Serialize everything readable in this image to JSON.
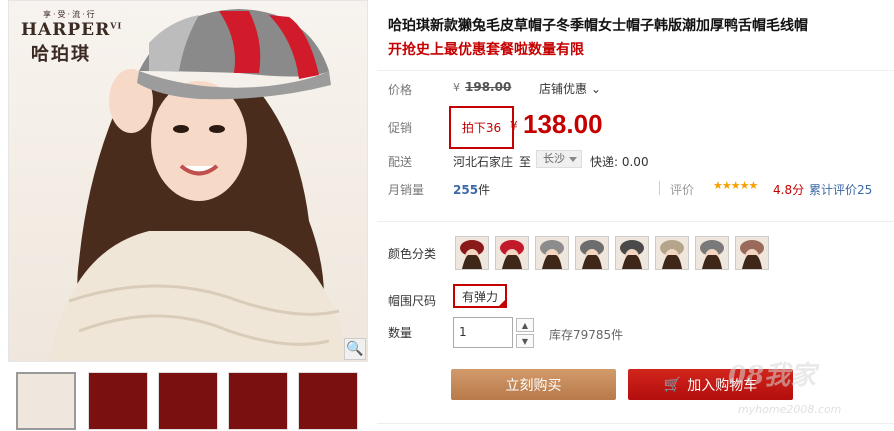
{
  "brand": {
    "tagline": "享·受·流·行",
    "name_en": "HARPER",
    "name_en_sup": "VI",
    "name_cn": "哈珀琪"
  },
  "product": {
    "title": "哈珀琪新款獭兔毛皮草帽子冬季帽女士帽子韩版潮加厚鸭舌帽毛线帽",
    "subtitle": "开抢史上最优惠套餐啦数量有限"
  },
  "price": {
    "label": "价格",
    "currency": "¥",
    "original": "198.00",
    "store_discount": "店铺优惠"
  },
  "promo": {
    "label": "促销",
    "tag": "拍下36",
    "currency": "¥",
    "price": "138.00"
  },
  "shipping": {
    "label": "配送",
    "from": "河北石家庄",
    "to_label": "至",
    "to_value": "长沙",
    "fee": "快递: 0.00"
  },
  "sales": {
    "label": "月销量",
    "count": "255",
    "unit": "件",
    "rating_label": "评价",
    "stars": "★★★★★",
    "score": "4.8分",
    "reviews_link": "累计评价25"
  },
  "options": {
    "color_label": "颜色分类",
    "color_count": 8,
    "size_label": "帽围尺码",
    "size_value": "有弹力",
    "qty_label": "数量",
    "qty_value": "1",
    "stock": "库存79785件"
  },
  "actions": {
    "buy_now": "立刻购买",
    "add_to_cart": "加入购物车"
  },
  "watermark": {
    "main": "08我家",
    "url": "myhome2008.com"
  },
  "colors": {
    "accent": "#c40000",
    "buy_now": "#c4885a",
    "add_cart": "#c20f0f",
    "link": "#3c6aa6",
    "star": "#f5a000"
  }
}
